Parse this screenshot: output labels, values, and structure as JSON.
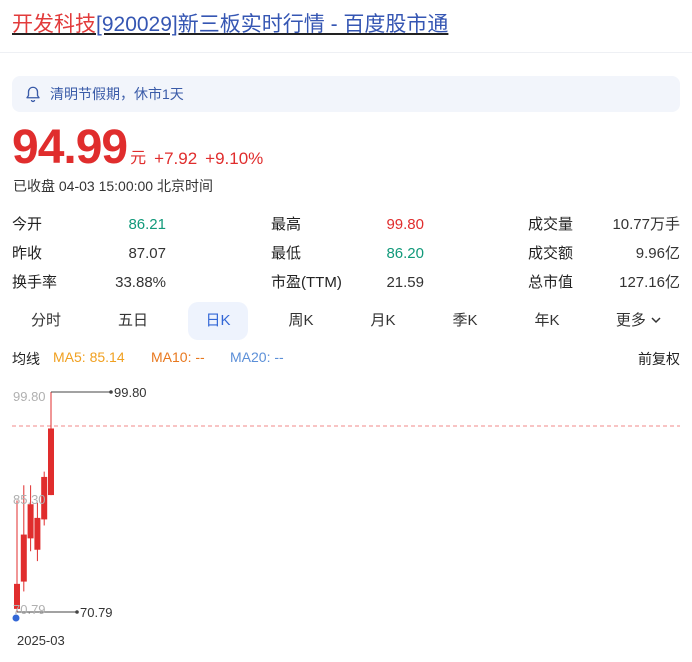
{
  "page": {
    "title_name": "开发科技",
    "title_rest": "[920029]新三板实时行情 - 百度股市通"
  },
  "notice": {
    "icon": "bell-icon",
    "text": "清明节假期，休市1天"
  },
  "quote": {
    "price": "94.99",
    "unit": "元",
    "change": "+7.92",
    "change_pct": "+9.10%",
    "status": "已收盘 04-03 15:00:00 北京时间"
  },
  "stats": [
    {
      "label": "今开",
      "value": "86.21",
      "color": "green"
    },
    {
      "label": "最高",
      "value": "99.80",
      "color": "red"
    },
    {
      "label": "成交量",
      "value": "10.77万手",
      "color": "dark"
    },
    {
      "label": "昨收",
      "value": "87.07",
      "color": "dark"
    },
    {
      "label": "最低",
      "value": "86.20",
      "color": "green"
    },
    {
      "label": "成交额",
      "value": "9.96亿",
      "color": "dark"
    },
    {
      "label": "换手率",
      "value": "33.88%",
      "color": "dark"
    },
    {
      "label": "市盈(TTM)",
      "value": "21.59",
      "color": "dark"
    },
    {
      "label": "总市值",
      "value": "127.16亿",
      "color": "dark"
    }
  ],
  "tabs": [
    "分时",
    "五日",
    "日K",
    "周K",
    "月K",
    "季K",
    "年K",
    "更多"
  ],
  "active_tab": "日K",
  "indicators": {
    "label": "均线",
    "ma5": "MA5: 85.14",
    "ma10": "MA10: --",
    "ma20": "MA20: --",
    "adjust": "前复权"
  },
  "colors": {
    "up": "#e02d2d",
    "down": "#11997a",
    "accent": "#3367d6",
    "ma5": "#f0a020",
    "ma10": "#e8781e",
    "ma20": "#5b8fd8"
  },
  "chart_data": {
    "type": "candlestick",
    "y_axis_labels": [
      "99.80",
      "85.30",
      "70.79"
    ],
    "annotations": {
      "high": "99.80",
      "low": "70.79"
    },
    "x_labels": [
      "2025-03"
    ],
    "reference_line": 94.99,
    "ylim": [
      70.79,
      99.8
    ],
    "candles": [
      {
        "open": 71.2,
        "close": 74.5,
        "high": 85.5,
        "low": 70.79
      },
      {
        "open": 74.8,
        "close": 81.0,
        "high": 87.5,
        "low": 73.5
      },
      {
        "open": 80.5,
        "close": 85.0,
        "high": 87.5,
        "low": 78.8
      },
      {
        "open": 79.0,
        "close": 83.2,
        "high": 85.2,
        "low": 77.5
      },
      {
        "open": 83.0,
        "close": 88.6,
        "high": 89.3,
        "low": 82.2
      },
      {
        "open": 86.21,
        "close": 94.99,
        "high": 99.8,
        "low": 86.2
      }
    ]
  }
}
